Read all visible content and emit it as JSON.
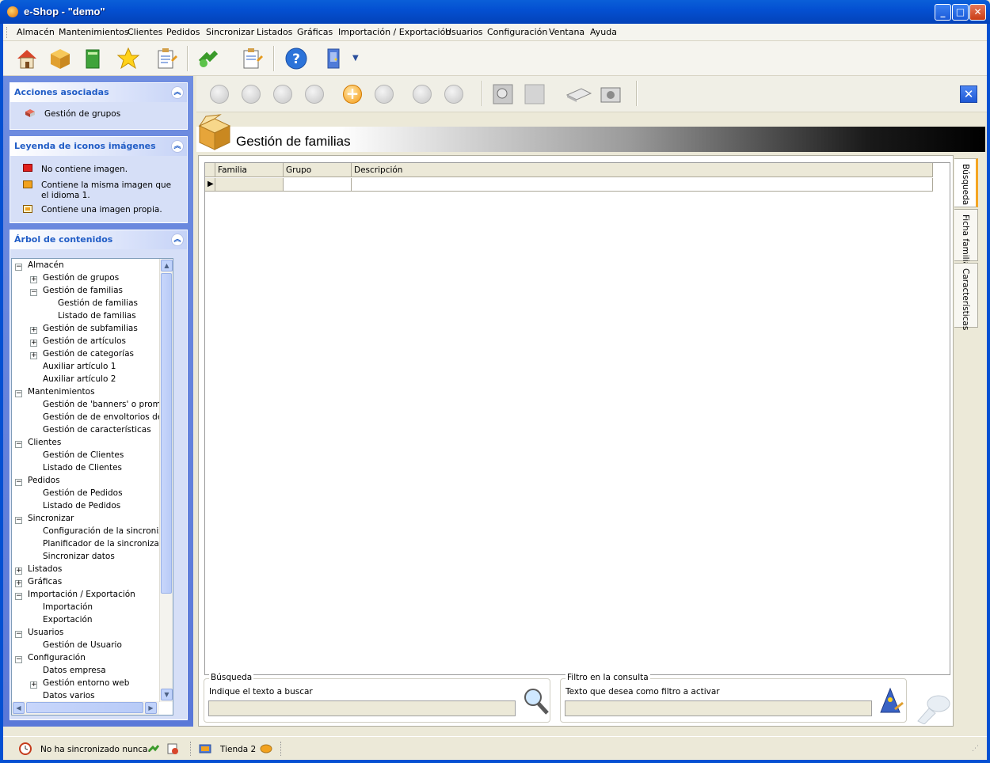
{
  "window": {
    "title": "e-Shop - \"demo\"",
    "minimize": "_",
    "maximize": "□",
    "close": "✕"
  },
  "menu": [
    "Almacén",
    "Mantenimientos",
    "Clientes",
    "Pedidos",
    "Sincronizar",
    "Listados",
    "Gráficas",
    "Importación / Exportación",
    "Usuarios",
    "Configuración",
    "Ventana",
    "Ayuda"
  ],
  "left": {
    "actions": {
      "title": "Acciones asociadas",
      "items": [
        "Gestión de grupos"
      ]
    },
    "legend": {
      "title": "Leyenda de iconos imágenes",
      "items": [
        "No contiene imagen.",
        "Contiene la misma imagen que",
        "el idioma 1.",
        "Contiene una imagen propia."
      ]
    },
    "tree": {
      "title": "Árbol de contenidos",
      "items": [
        "Almacén",
        "Gestión de grupos",
        "Gestión de familias",
        "Gestión de familias",
        "Listado de familias",
        "Gestión de subfamilias",
        "Gestión de artículos",
        "Gestión de categorías",
        "Auxiliar artículo 1",
        "Auxiliar artículo 2",
        "Mantenimientos",
        "Gestión de 'banners' o promoci",
        "Gestión de de envoltorios de e",
        "Gestión de características",
        "Clientes",
        "Gestión de Clientes",
        "Listado de Clientes",
        "Pedidos",
        "Gestión de Pedidos",
        "Listado de Pedidos",
        "Sincronizar",
        "Configuración de la sincronizac",
        "Planificador de la sincronizació",
        "Sincronizar datos",
        "Listados",
        "Gráficas",
        "Importación / Exportación",
        "Importación",
        "Exportación",
        "Usuarios",
        "Gestión de Usuario",
        "Configuración",
        "Datos empresa",
        "Gestión entorno web",
        "Datos varios"
      ]
    }
  },
  "main": {
    "title": "Gestión de familias",
    "columns": [
      "Familia",
      "Grupo",
      "Descripción"
    ],
    "tabs": [
      "Búsqueda",
      "Ficha familia",
      "Características"
    ],
    "search": {
      "label": "Búsqueda",
      "hint": "Indique el texto a buscar",
      "value": ""
    },
    "filter": {
      "label": "Filtro en la consulta",
      "hint": "Texto que desea como filtro a activar",
      "value": ""
    }
  },
  "status": {
    "sync": "No ha sincronizado nunca.",
    "store": "Tienda 2"
  }
}
